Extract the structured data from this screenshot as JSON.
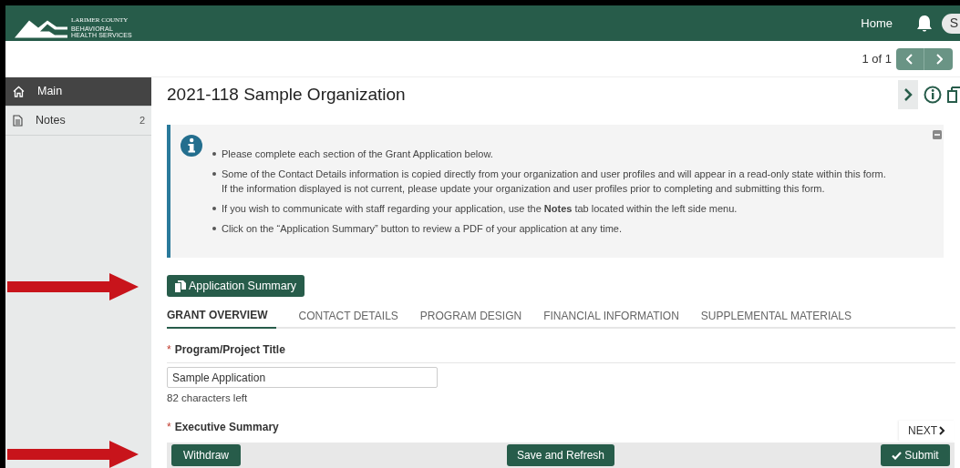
{
  "header": {
    "logo": {
      "top_text": "LARIMER COUNTY",
      "line_1": "BEHAVIORAL",
      "line_2": "HEALTH SERVICES"
    },
    "nav_link": "Home",
    "avatar": "S"
  },
  "pager": {
    "text": "1 of 1"
  },
  "sidebar": {
    "items": [
      {
        "kind": "home",
        "label": "Main",
        "selected": true
      },
      {
        "kind": "note",
        "label": "Notes",
        "count": "2",
        "selected": false
      }
    ]
  },
  "page_title": "2021-118 Sample Organization",
  "info_box": {
    "bullets": [
      "Please complete each section of the Grant Application below.",
      "Some of the Contact Details information is copied directly from your organization and user profiles and will appear in a read-only state within this form.\nIf the information displayed is not current, please update your organization and user profiles prior to completing and submitting this form.",
      "If you wish to communicate with staff regarding your application, use the **Notes** tab located within the left side menu.",
      "Click on the “Application Summary” button to review a PDF of your application at any time."
    ]
  },
  "summary_button": "Application Summary",
  "tabs": [
    {
      "label": "GRANT OVERVIEW",
      "selected": true
    },
    {
      "label": "CONTACT DETAILS",
      "selected": false
    },
    {
      "label": "PROGRAM DESIGN",
      "selected": false
    },
    {
      "label": "FINANCIAL INFORMATION",
      "selected": false
    },
    {
      "label": "SUPPLEMENTAL MATERIALS",
      "selected": false
    }
  ],
  "fields": [
    {
      "required_mark": "*",
      "label": "Program/Project Title",
      "value": "Sample Application",
      "hint": "82 characters left"
    },
    {
      "required_mark": "*",
      "label": "Executive Summary"
    }
  ],
  "next_button": "NEXT",
  "actions": {
    "withdraw": "Withdraw",
    "save": "Save and Refresh",
    "submit": "Submit"
  },
  "annotations": [
    {
      "kind": "arrow"
    },
    {
      "kind": "arrow"
    }
  ]
}
